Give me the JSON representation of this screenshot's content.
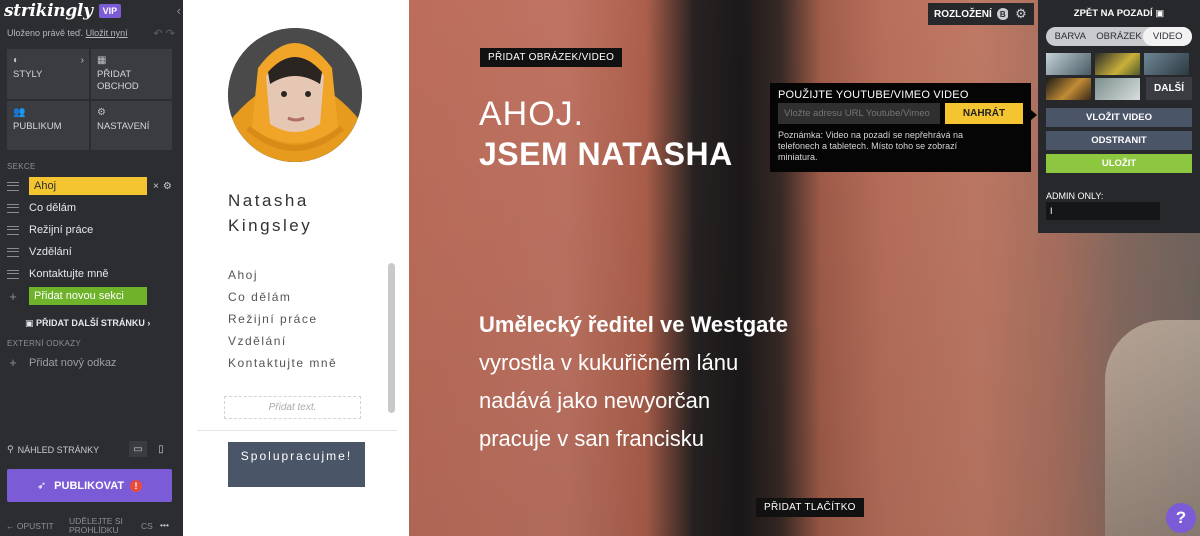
{
  "editor": {
    "logo": "strikingly",
    "vip": "VIP",
    "saved_status": "Uloženo právě teď.",
    "save_now": "Uložit nyní",
    "tiles": [
      "STYLY",
      "PŘIDAT OBCHOD",
      "PUBLIKUM",
      "NASTAVENÍ"
    ],
    "sections_label": "SEKCE",
    "sections": [
      "Ahoj",
      "Co dělám",
      "Režijní práce",
      "Vzdělání",
      "Kontaktujte mně"
    ],
    "add_section": "Přidat novou sekci",
    "add_page": "PŘIDAT DALŠÍ STRÁNKU",
    "external_links_label": "EXTERNÍ ODKAZY",
    "add_link": "Přidat nový odkaz",
    "preview_label": "NÁHLED STRÁNKY",
    "publish": "PUBLIKOVAT",
    "publish_warning": "!",
    "footer": {
      "exit": "OPUSTIT",
      "tour": "UDĚLEJTE SI PROHLÍDKU",
      "lang": "CS",
      "more": "•••"
    }
  },
  "site": {
    "first_name": "Natasha",
    "last_name": "Kingsley",
    "nav": [
      "Ahoj",
      "Co dělám",
      "Režijní práce",
      "Vzdělání",
      "Kontaktujte mně"
    ],
    "add_text": "Přidat text.",
    "collab_button": "Spolupracujme!"
  },
  "hero": {
    "add_media": "PŘIDAT OBRÁZEK/VIDEO",
    "hello": "AHOJ.",
    "headline": "JSEM NATASHA",
    "lines": [
      "Umělecký ředitel ve Westgate",
      "vyrostla v kukuřičném lánu",
      "nadává jako newyorčan",
      "pracuje v san francisku"
    ],
    "add_button": "PŘIDAT TLAČÍTKO",
    "layout": "ROZLOŽENÍ",
    "layout_badge": "B"
  },
  "video_popover": {
    "title": "POUŽIJTE YOUTUBE/VIMEO VIDEO",
    "placeholder": "Vložte adresu URL Youtube/Vimeo",
    "upload": "NAHRÁT",
    "note": "Poznámka: Video na pozadí se nepřehrává na telefonech a tabletech. Místo toho se zobrazí miniatura."
  },
  "background_panel": {
    "back": "ZPĚT NA POZADÍ",
    "tabs": [
      "BARVA",
      "OBRÁZEK",
      "VIDEO"
    ],
    "active_tab": "VIDEO",
    "more": "DALŠÍ",
    "insert_video": "VLOŽIT VIDEO",
    "remove": "ODSTRANIT",
    "save": "ULOŽIT",
    "admin_label": "ADMIN ONLY:",
    "admin_value": "I"
  },
  "help": "?",
  "colors": {
    "accent_purple": "#7b5bd6",
    "yellow": "#f4c531",
    "green": "#6fb32b",
    "sidebar": "#2b2d31"
  }
}
